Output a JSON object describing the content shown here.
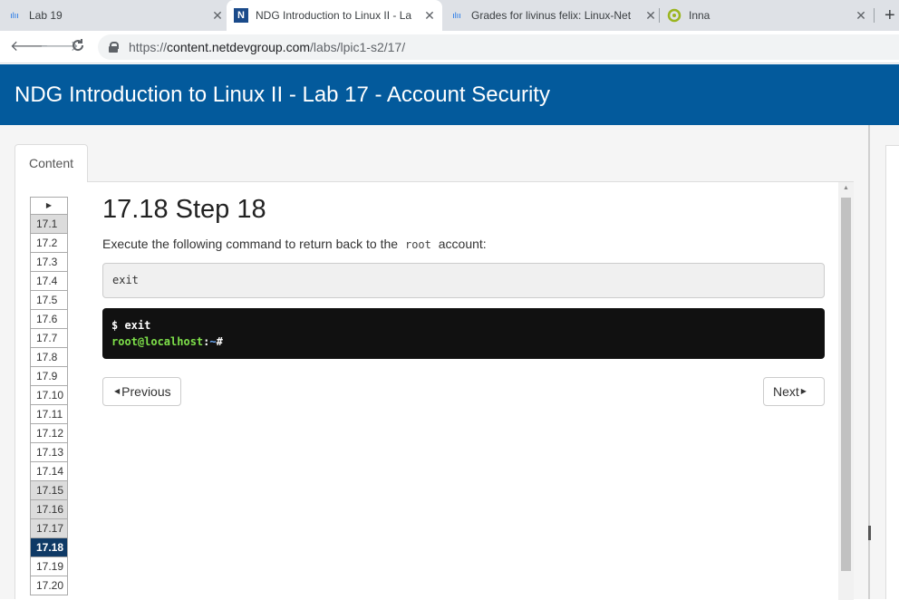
{
  "browser": {
    "tabs": [
      {
        "title": "Lab 19",
        "favicon": "cisco-icon"
      },
      {
        "title": "NDG Introduction to Linux II - La",
        "favicon": "ndg-icon",
        "active": true
      },
      {
        "title": "Grades for livinus felix: Linux-Net",
        "favicon": "cisco-icon"
      },
      {
        "title": "Inna",
        "favicon": "ring-icon"
      }
    ],
    "new_tab": "+",
    "url_scheme": "https://",
    "url_domain": "content.netdevgroup.com",
    "url_path": "/labs/lpic1-s2/17/"
  },
  "header": {
    "title": "NDG Introduction to Linux II - Lab 17 - Account Security"
  },
  "content_tab": "Content",
  "steps": {
    "items": [
      {
        "label": "17.1",
        "state": "visited"
      },
      {
        "label": "17.2",
        "state": ""
      },
      {
        "label": "17.3",
        "state": ""
      },
      {
        "label": "17.4",
        "state": ""
      },
      {
        "label": "17.5",
        "state": ""
      },
      {
        "label": "17.6",
        "state": ""
      },
      {
        "label": "17.7",
        "state": ""
      },
      {
        "label": "17.8",
        "state": ""
      },
      {
        "label": "17.9",
        "state": ""
      },
      {
        "label": "17.10",
        "state": ""
      },
      {
        "label": "17.11",
        "state": ""
      },
      {
        "label": "17.12",
        "state": ""
      },
      {
        "label": "17.13",
        "state": ""
      },
      {
        "label": "17.14",
        "state": ""
      },
      {
        "label": "17.15",
        "state": "visited"
      },
      {
        "label": "17.16",
        "state": "visited"
      },
      {
        "label": "17.17",
        "state": "visited"
      },
      {
        "label": "17.18",
        "state": "current"
      },
      {
        "label": "17.19",
        "state": ""
      },
      {
        "label": "17.20",
        "state": ""
      }
    ]
  },
  "main": {
    "step_title": "17.18 Step 18",
    "instruction_before": "Execute the following command to return back to the",
    "instruction_code": "root",
    "instruction_after": "account:",
    "command": "exit",
    "terminal": {
      "line1": "$ exit",
      "prompt_user": "root@localhost",
      "prompt_colon": ":",
      "prompt_path": "~",
      "prompt_hash": "#"
    },
    "previous_label": "Previous",
    "next_label": "Next"
  },
  "colors": {
    "header_bg": "#035a9c",
    "current_step_bg": "#0f3a66",
    "prompt_user": "#7ee04a"
  }
}
